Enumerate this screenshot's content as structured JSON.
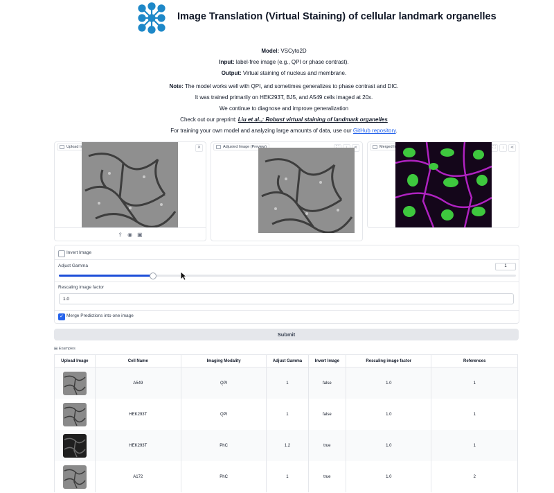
{
  "header": {
    "title": "Image Translation (Virtual Staining) of cellular landmark organelles",
    "logo_color": "#1e88c8"
  },
  "info": {
    "model_label": "Model:",
    "model_value": "VSCyto2D",
    "input_label": "Input:",
    "input_value": "label-free image (e.g., QPI or phase contrast).",
    "output_label": "Output:",
    "output_value": "Virtual staining of nucleus and membrane.",
    "note_label": "Note:",
    "note_line1": "The model works well with QPI, and sometimes generalizes to phase contrast and DIC.",
    "note_line2": "It was trained primarily on HEK293T, BJ5, and A549 cells imaged at 20x.",
    "note_line3": "We continue to diagnose and improve generalization",
    "preprint_prefix": "Check out our preprint: ",
    "preprint_link": "Liu et al.,: Robust virtual staining of landmark organelles",
    "training_prefix": "For training your own model and analyzing large amounts of data, use our ",
    "github_link": "GitHub repository",
    "training_suffix": "."
  },
  "panels": {
    "upload_label": "Upload Image",
    "adjusted_label": "Adjusted Image (Preview)",
    "merged_label": "Merged Image",
    "nucleus_color": "#3ec83e",
    "membrane_color": "#c026d3"
  },
  "controls": {
    "invert_label": "Invert Image",
    "invert_checked": false,
    "gamma_label": "Adjust Gamma",
    "gamma_value": "1",
    "gamma_fraction": 0.205,
    "rescale_label": "Rescaling image factor",
    "rescale_value": "1.0",
    "merge_label": "Merge Predictions into one image",
    "merge_checked": true,
    "submit_label": "Submit",
    "accent_color": "#1d4ed8"
  },
  "examples": {
    "label": "Examples",
    "headers": [
      "Upload Image",
      "Cell Name",
      "Imaging Modality",
      "Adjust Gamma",
      "Invert Image",
      "Rescaling image factor",
      "References"
    ],
    "rows": [
      {
        "cell": "A549",
        "modality": "QPI",
        "gamma": "1",
        "invert": "false",
        "rescale": "1.0",
        "ref": "1",
        "thumb": "light"
      },
      {
        "cell": "HEK293T",
        "modality": "QPI",
        "gamma": "1",
        "invert": "false",
        "rescale": "1.0",
        "ref": "1",
        "thumb": "light"
      },
      {
        "cell": "HEK293T",
        "modality": "PhC",
        "gamma": "1.2",
        "invert": "true",
        "rescale": "1.0",
        "ref": "1",
        "thumb": "dark"
      },
      {
        "cell": "A172",
        "modality": "PhC",
        "gamma": "1",
        "invert": "true",
        "rescale": "1.0",
        "ref": "2",
        "thumb": "light"
      }
    ]
  }
}
